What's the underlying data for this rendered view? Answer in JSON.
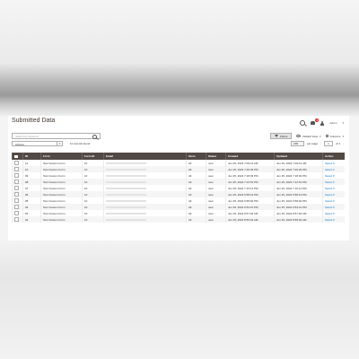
{
  "page": {
    "title": "Submitted Data"
  },
  "header": {
    "admin_name": "admin",
    "notification_count": "2"
  },
  "search": {
    "placeholder": "Search by keyword"
  },
  "toolbar": {
    "filters_label": "Filters",
    "view_label": "Default View",
    "columns_label": "Columns"
  },
  "actions": {
    "label": "Actions"
  },
  "records": {
    "label": "11 records found"
  },
  "pager": {
    "per_page": "200",
    "per_page_label": "per page",
    "page": "1",
    "of_label": "of 1"
  },
  "table": {
    "columns": [
      "",
      "ID",
      "Form",
      "Form ID",
      "Email",
      "Store",
      "Status",
      "Created",
      "Updated",
      "Action"
    ],
    "rows": [
      {
        "id": "11",
        "form": "Test Custom Form",
        "form_id": "10",
        "store": "All",
        "status": "new",
        "created": "Jun 25, 2024 7:09:13 AM",
        "updated": "Jun 25, 2024 7:09:13 AM",
        "action": "Select"
      },
      {
        "id": "10",
        "form": "Test Custom Form",
        "form_id": "10",
        "store": "All",
        "status": "new",
        "created": "Jun 25, 2024 7:20:29 PM",
        "updated": "Jun 25, 2024 7:20:29 PM",
        "action": "Select"
      },
      {
        "id": "09",
        "form": "Test Custom Form",
        "form_id": "10",
        "store": "All",
        "status": "new",
        "created": "Jun 25, 2024 7:18:03 PM",
        "updated": "Jun 25, 2024 7:18:03 PM",
        "action": "Select"
      },
      {
        "id": "08",
        "form": "Test Custom Form",
        "form_id": "10",
        "store": "All",
        "status": "new",
        "created": "Jun 25, 2024 7:12:51 PM",
        "updated": "Jun 25, 2024 7:12:51 PM",
        "action": "Select"
      },
      {
        "id": "07",
        "form": "Test Custom Form",
        "form_id": "10",
        "store": "All",
        "status": "new",
        "created": "Jun 25, 2024 7:10:14 PM",
        "updated": "Jun 25, 2024 7:10:14 PM",
        "action": "Select"
      },
      {
        "id": "06",
        "form": "Test Custom Form",
        "form_id": "10",
        "store": "All",
        "status": "new",
        "created": "Jun 25, 2024 6:58:13 PM",
        "updated": "Jun 25, 2024 6:58:13 PM",
        "action": "Select"
      },
      {
        "id": "05",
        "form": "Test Custom Form",
        "form_id": "10",
        "store": "All",
        "status": "new",
        "created": "Jun 25, 2024 6:58:02 PM",
        "updated": "Jun 25, 2024 6:58:02 PM",
        "action": "Select"
      },
      {
        "id": "04",
        "form": "Test Custom Form",
        "form_id": "10",
        "store": "All",
        "status": "new",
        "created": "Jun 25, 2024 6:54:21 PM",
        "updated": "Jun 25, 2024 6:54:21 PM",
        "action": "Select"
      },
      {
        "id": "03",
        "form": "Test Custom Form",
        "form_id": "10",
        "store": "All",
        "status": "new",
        "created": "Jun 25, 2024 8:57:18 AM",
        "updated": "Jun 25, 2024 8:57:18 AM",
        "action": "Select"
      },
      {
        "id": "02",
        "form": "Test Custom Form",
        "form_id": "10",
        "store": "All",
        "status": "new",
        "created": "Jun 25, 2024 8:55:04 AM",
        "updated": "Jun 25, 2024 8:55:04 AM",
        "action": "Select"
      }
    ]
  }
}
